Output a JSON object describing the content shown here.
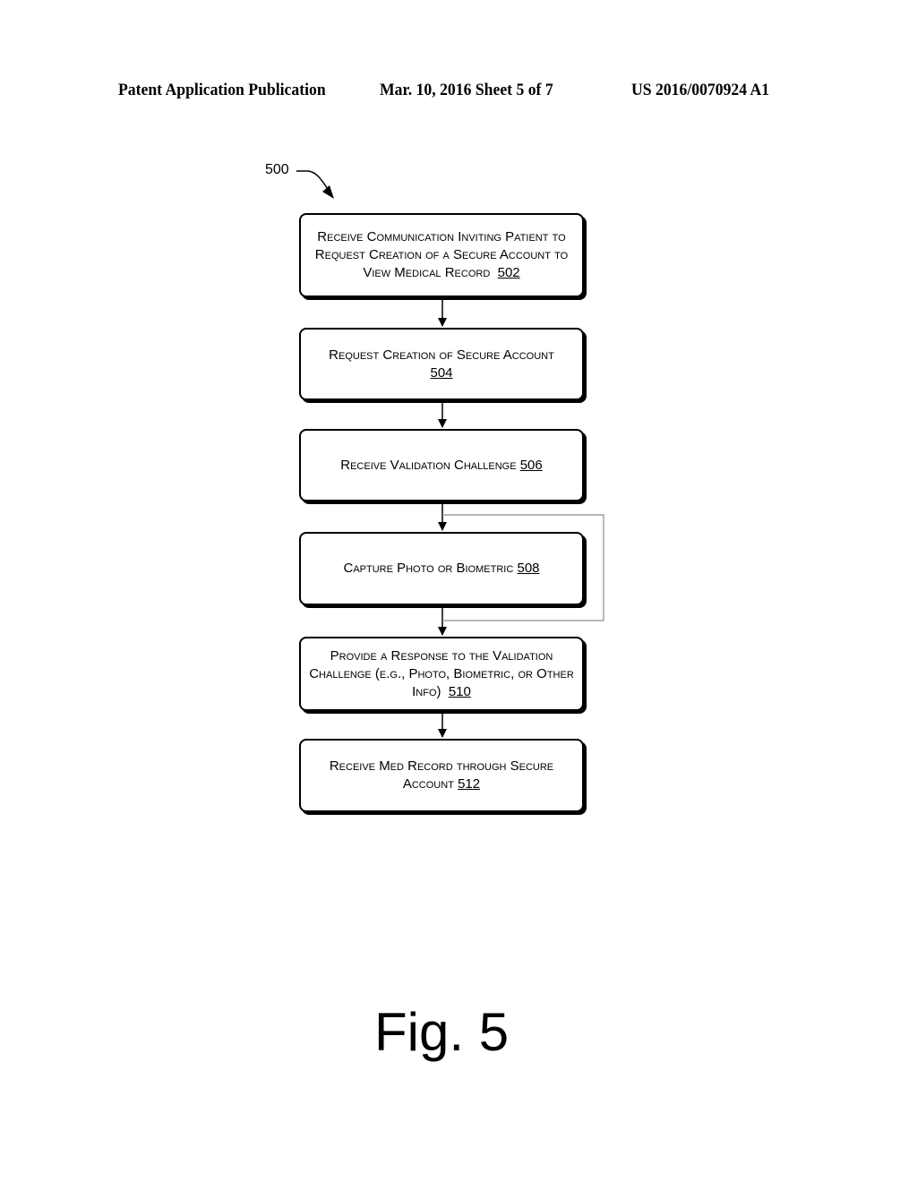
{
  "header": {
    "left": "Patent Application Publication",
    "middle": "Mar. 10, 2016  Sheet 5 of 7",
    "right": "US 2016/0070924 A1"
  },
  "diagram": {
    "reference": "500",
    "steps": [
      {
        "text": "Receive Communication Inviting Patient to Request Creation of a Secure Account to View Medical Record",
        "num": "502"
      },
      {
        "text": "Request Creation of Secure Account",
        "num": "504"
      },
      {
        "text": "Receive Validation Challenge",
        "num": "506"
      },
      {
        "text": "Capture Photo or Biometric",
        "num": "508"
      },
      {
        "text": "Provide a Response to the Validation Challenge (e.g., Photo, Biometric, or Other Info)",
        "num": "510"
      },
      {
        "text": "Receive Med Record through Secure Account",
        "num": "512"
      }
    ],
    "loop": {
      "from": "506",
      "to": "510",
      "bypasses": "508"
    }
  },
  "figure_label": "Fig. 5"
}
